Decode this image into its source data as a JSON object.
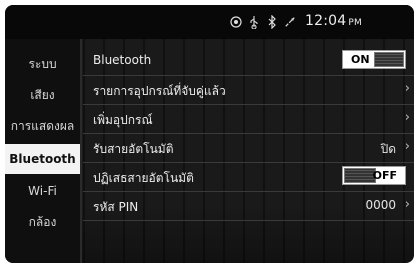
{
  "status": {
    "icons": [
      "record-icon",
      "usb-icon",
      "bluetooth-icon",
      "phone-signal-icon"
    ],
    "time": "12:04",
    "ampm": "PM"
  },
  "sidebar": {
    "items": [
      {
        "label": "ระบบ",
        "active": false
      },
      {
        "label": "เสียง",
        "active": false
      },
      {
        "label": "การแสดงผล",
        "active": false
      },
      {
        "label": "Bluetooth",
        "active": true
      },
      {
        "label": "Wi-Fi",
        "active": false
      },
      {
        "label": "กล้อง",
        "active": false
      }
    ]
  },
  "list": {
    "rows": [
      {
        "label": "Bluetooth",
        "toggle": "ON"
      },
      {
        "label": "รายการอุปกรณ์ที่จับคู่แล้ว",
        "chevron": "›"
      },
      {
        "label": "เพิ่มอุปกรณ์",
        "chevron": "›"
      },
      {
        "label": "รับสายอัตโนมัติ",
        "value": "ปิด",
        "chevron": "›"
      },
      {
        "label": "ปฏิเสธสายอัตโนมัติ",
        "toggle": "OFF"
      },
      {
        "label": "รหัส PIN",
        "value": "0000",
        "chevron": "›"
      }
    ]
  }
}
